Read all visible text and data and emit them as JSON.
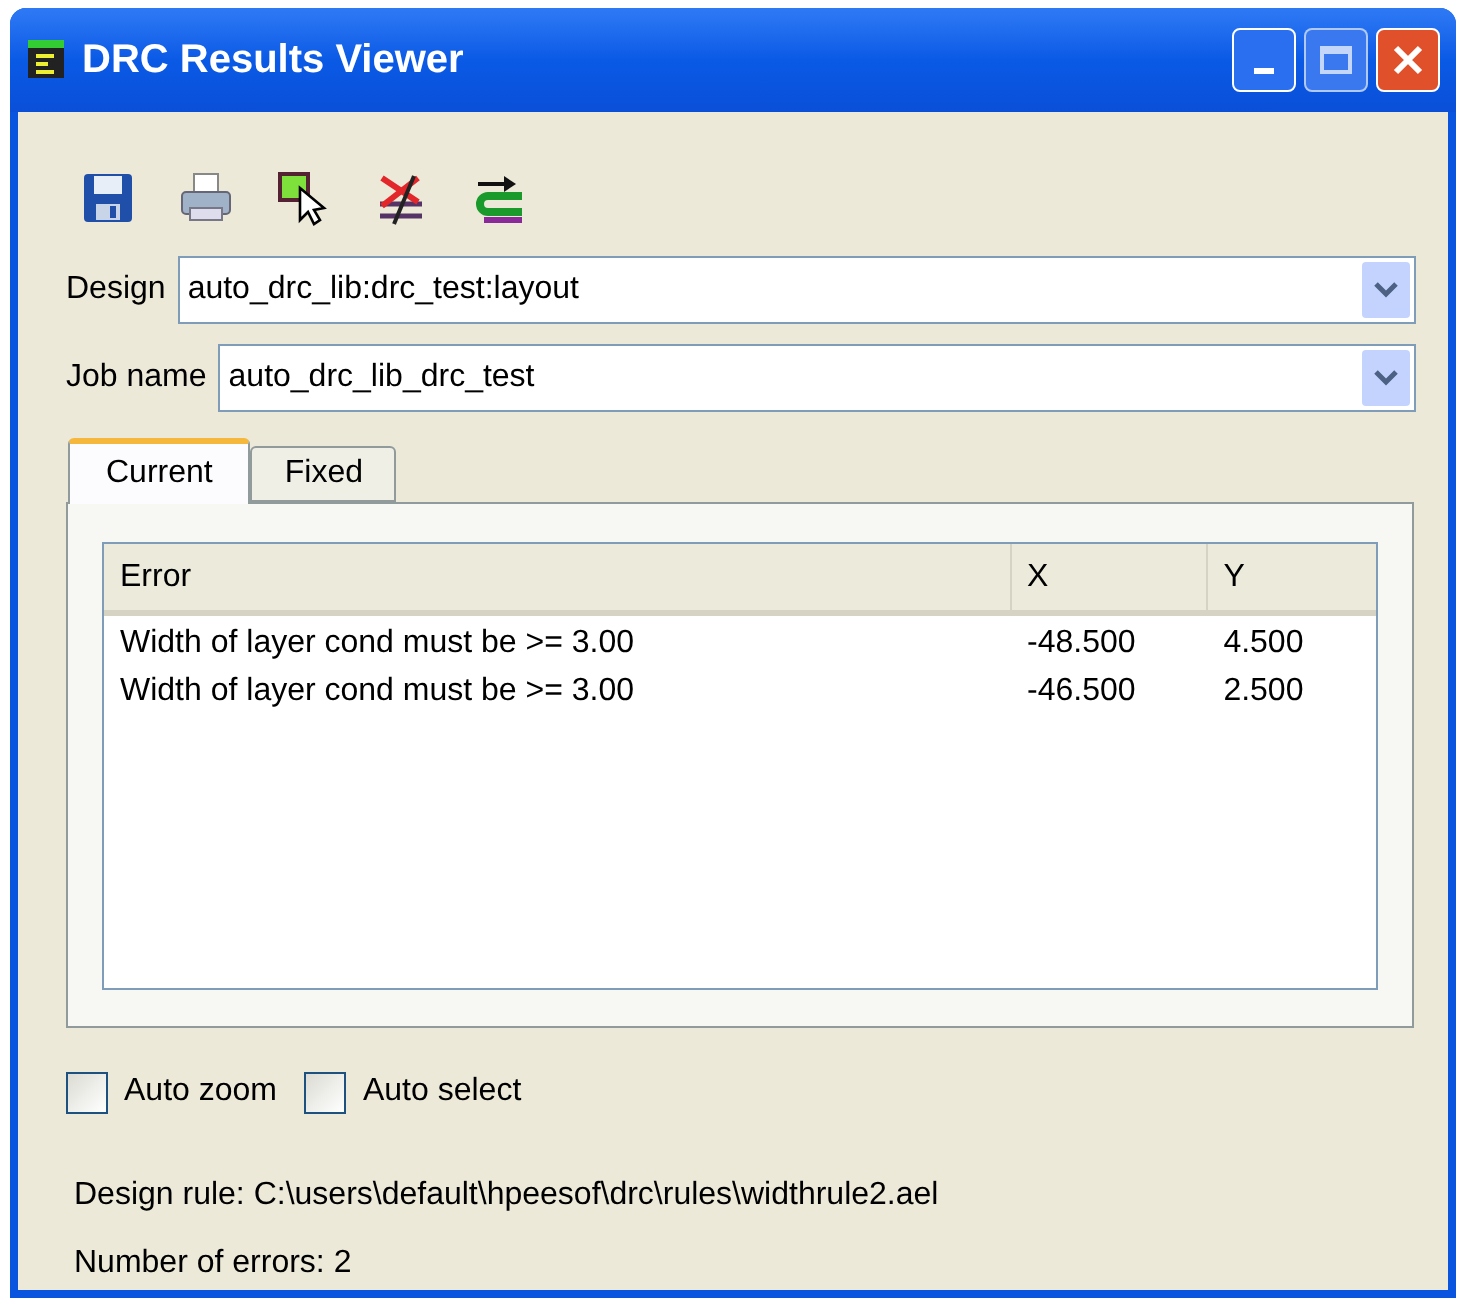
{
  "window": {
    "title": "DRC Results Viewer"
  },
  "toolbar": [
    {
      "kind": "save"
    },
    {
      "kind": "print"
    },
    {
      "kind": "select"
    },
    {
      "kind": "clear"
    },
    {
      "kind": "load"
    }
  ],
  "design": {
    "label": "Design",
    "value": "auto_drc_lib:drc_test:layout"
  },
  "job_name": {
    "label": "Job name",
    "value": "auto_drc_lib_drc_test"
  },
  "tabs": [
    {
      "label": "Current",
      "selected": true
    },
    {
      "label": "Fixed",
      "selected": false
    }
  ],
  "table": {
    "columns": [
      "Error",
      "X",
      "Y"
    ],
    "rows": [
      [
        "Width of layer cond must be >= 3.00",
        "-48.500",
        "4.500"
      ],
      [
        "Width of layer cond must be >= 3.00",
        "-46.500",
        "2.500"
      ]
    ]
  },
  "options": [
    {
      "label": "Auto zoom",
      "checked": false
    },
    {
      "label": "Auto select",
      "checked": false
    }
  ],
  "status": [
    "Design rule: C:\\users\\default\\hpeesof\\drc\\rules\\widthrule2.ael",
    "Number of errors: 2"
  ]
}
